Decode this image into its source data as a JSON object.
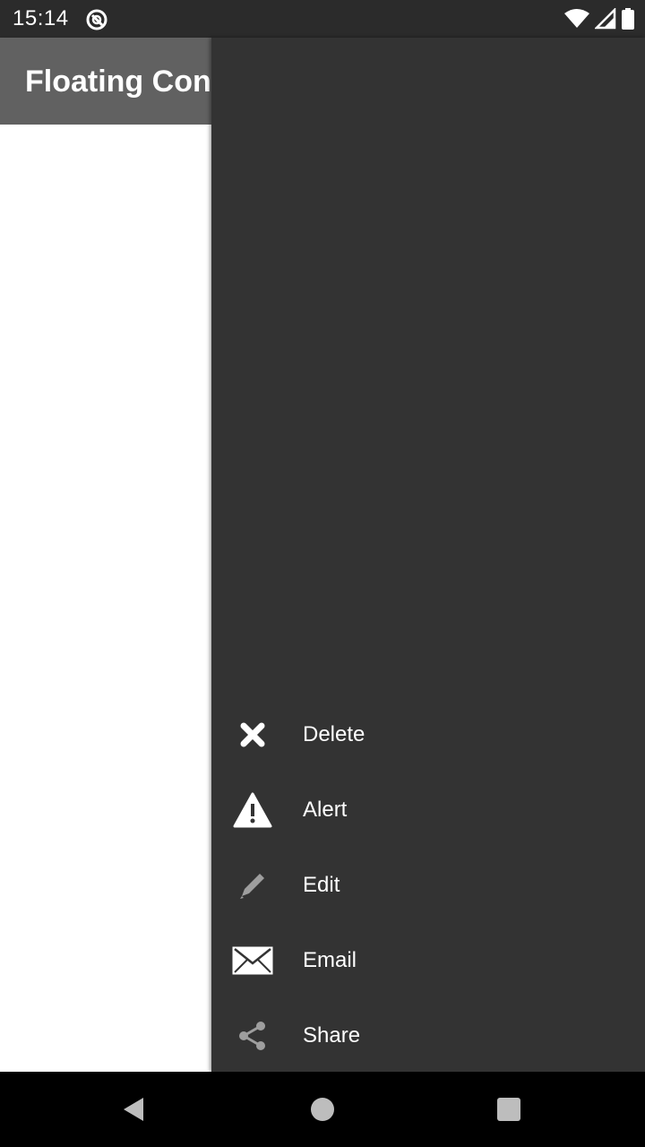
{
  "status_bar": {
    "time": "15:14",
    "icons": [
      "app-notification-icon",
      "wifi-icon",
      "cellular-signal-icon",
      "battery-icon"
    ]
  },
  "app_bar": {
    "title": "Floating Cont"
  },
  "menu": {
    "items": [
      {
        "label": "Delete",
        "icon": "delete-x-icon"
      },
      {
        "label": "Alert",
        "icon": "alert-warning-icon"
      },
      {
        "label": "Edit",
        "icon": "pencil-icon"
      },
      {
        "label": "Email",
        "icon": "envelope-icon"
      },
      {
        "label": "Share",
        "icon": "share-icon"
      }
    ]
  },
  "nav_bar": {
    "icons": [
      "back-icon",
      "home-icon",
      "recents-icon"
    ]
  },
  "colors": {
    "status_bar": "#2b2b2b",
    "app_bar": "#616161",
    "menu_panel": "#333333",
    "nav_bar": "#000000"
  }
}
